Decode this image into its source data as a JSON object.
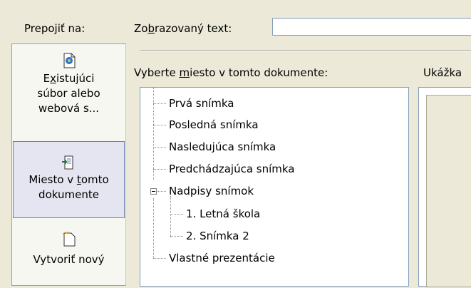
{
  "sidebar": {
    "title": "Prepojiť na:",
    "items": [
      {
        "label_a": "E",
        "label_u": "x",
        "label_b": "istujúci",
        "line2": "súbor alebo",
        "line3": "webová s..."
      },
      {
        "label": "Miesto v ",
        "label_u": "t",
        "label_b": "omto",
        "line2": "dokumente"
      },
      {
        "label": "Vytvoriť nový"
      }
    ]
  },
  "display_text": {
    "label_a": "Zo",
    "label_u": "b",
    "label_b": "razovaný text:",
    "value": ""
  },
  "place": {
    "label_a": "Vyberte ",
    "label_u": "m",
    "label_b": "iesto v tomto dokumente:"
  },
  "preview": {
    "label": "Ukážka"
  },
  "tree": {
    "items": [
      "Prvá snímka",
      "Posledná snímka",
      "Nasledujúca snímka",
      "Predchádzajúca snímka",
      "Nadpisy snímok",
      "1. Letná škola",
      "2. Snímka 2",
      "Vlastné prezentácie"
    ]
  }
}
